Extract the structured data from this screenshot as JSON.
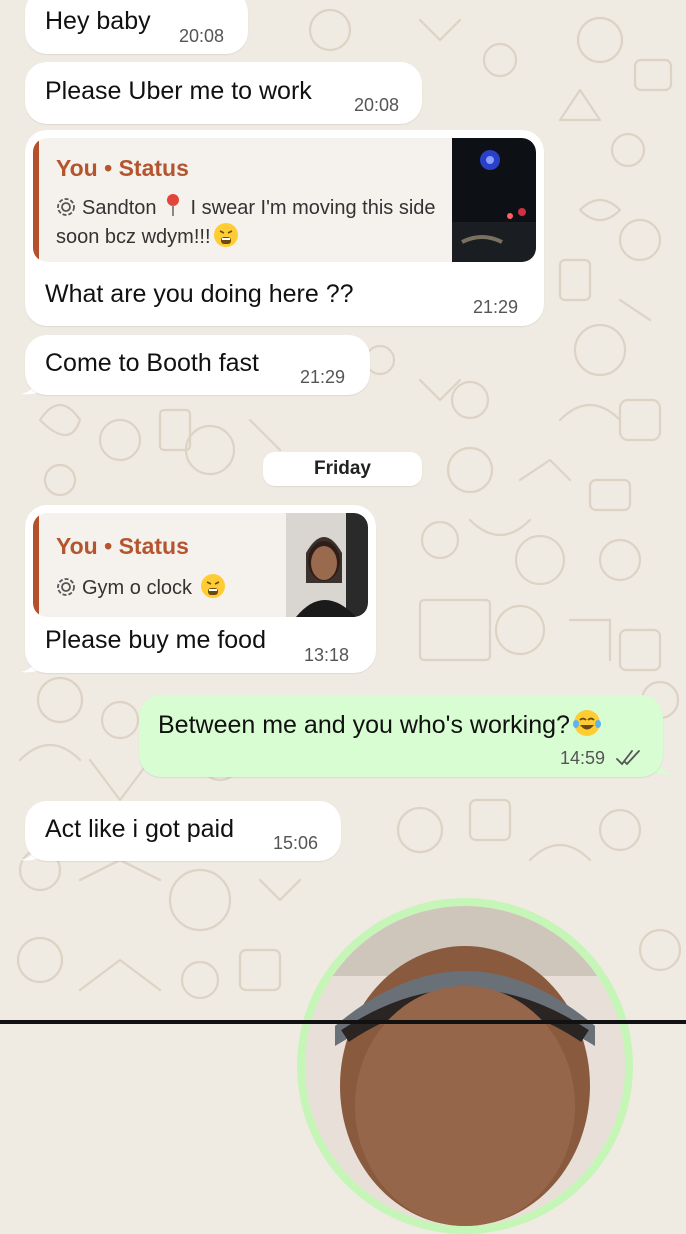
{
  "chat": {
    "messages": [
      {
        "text": "Hey baby",
        "time": "20:08"
      },
      {
        "text": "Please Uber me to work",
        "time": "20:08"
      },
      {
        "reply": {
          "author": "You • Status",
          "location": "Sandton",
          "caption": "I swear I'm moving this side soon bcz wdym!!!",
          "emoji": "tired-face-emoji"
        },
        "text": "What are you doing here ??",
        "time": "21:29"
      },
      {
        "text": "Come to Booth fast",
        "time": "21:29"
      },
      {
        "reply": {
          "author": "You • Status",
          "caption": "Gym o clock",
          "emoji": "tired-face-emoji"
        },
        "text": "Please buy me food",
        "time": "13:18"
      },
      {
        "text": "Between me and you who's working?",
        "time": "14:59",
        "outgoing": true,
        "emoji": "tears-of-joy-emoji",
        "status": "read-double-check"
      },
      {
        "text": "Act like i got paid",
        "time": "15:06"
      }
    ],
    "date_separator": "Friday"
  },
  "colors": {
    "incoming_bubble": "#ffffff",
    "outgoing_bubble": "#d9fdd3",
    "quote_accent": "#b5552f",
    "wallpaper": "#efeae2"
  }
}
